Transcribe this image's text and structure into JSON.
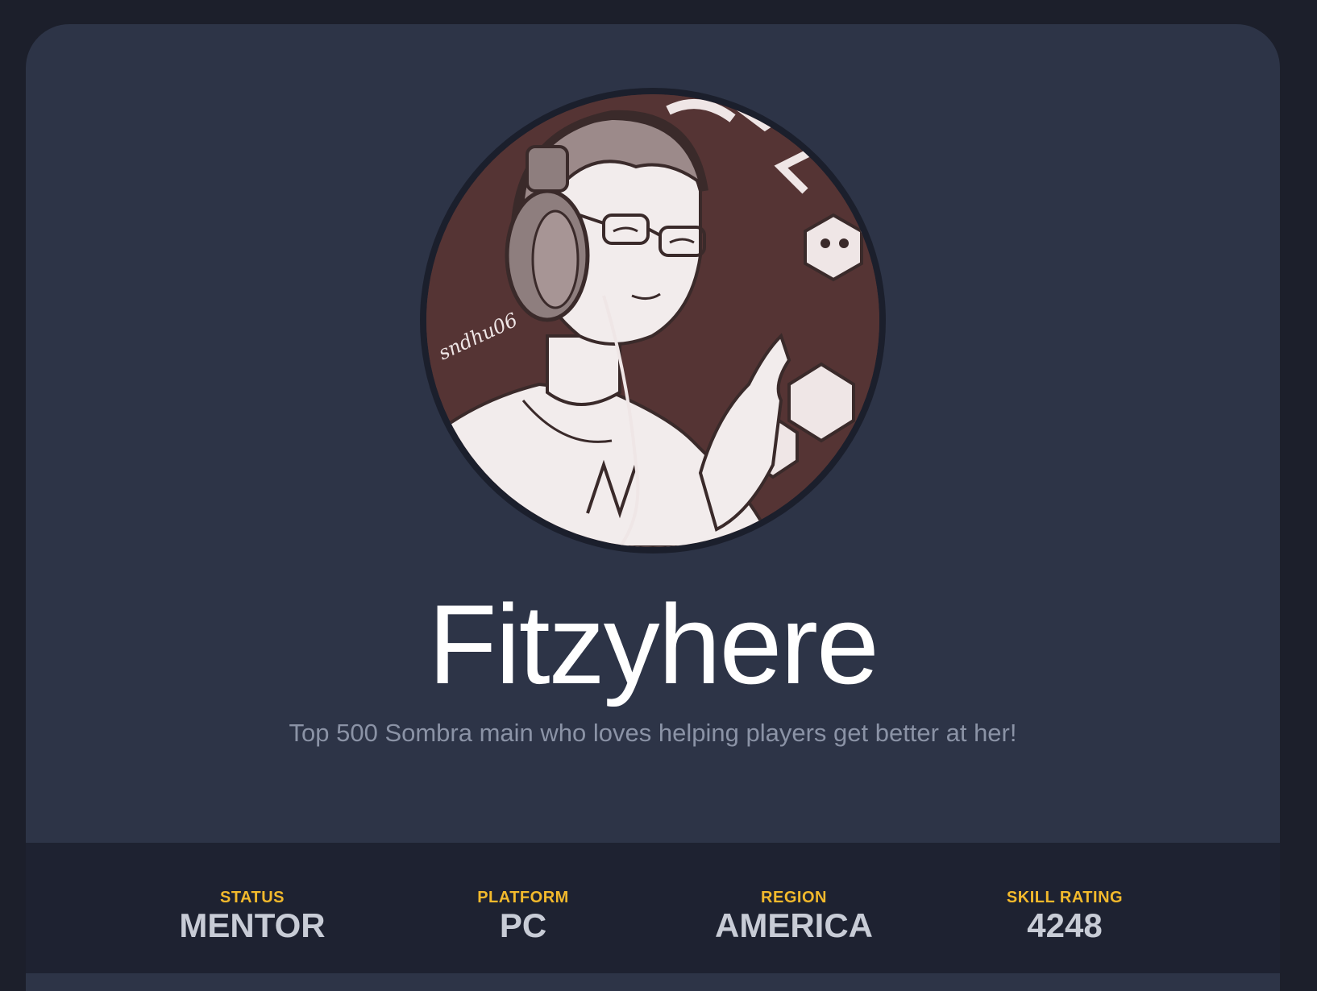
{
  "profile": {
    "username": "Fitzyhere",
    "bio": "Top 500 Sombra main who loves helping players get better at her!",
    "avatar_icon": "avatar-illustration-headphones"
  },
  "stats": [
    {
      "label": "STATUS",
      "value": "MENTOR"
    },
    {
      "label": "PLATFORM",
      "value": "PC"
    },
    {
      "label": "REGION",
      "value": "AMERICA"
    },
    {
      "label": "SKILL RATING",
      "value": "4248"
    }
  ],
  "colors": {
    "page_bg": "#1c1f2b",
    "card_bg": "#2d3447",
    "stats_bg": "#1e2231",
    "accent": "#f2b92c",
    "stat_value": "#c8ccd6",
    "bio_text": "#8b93a6",
    "avatar_bg": "#553434"
  }
}
